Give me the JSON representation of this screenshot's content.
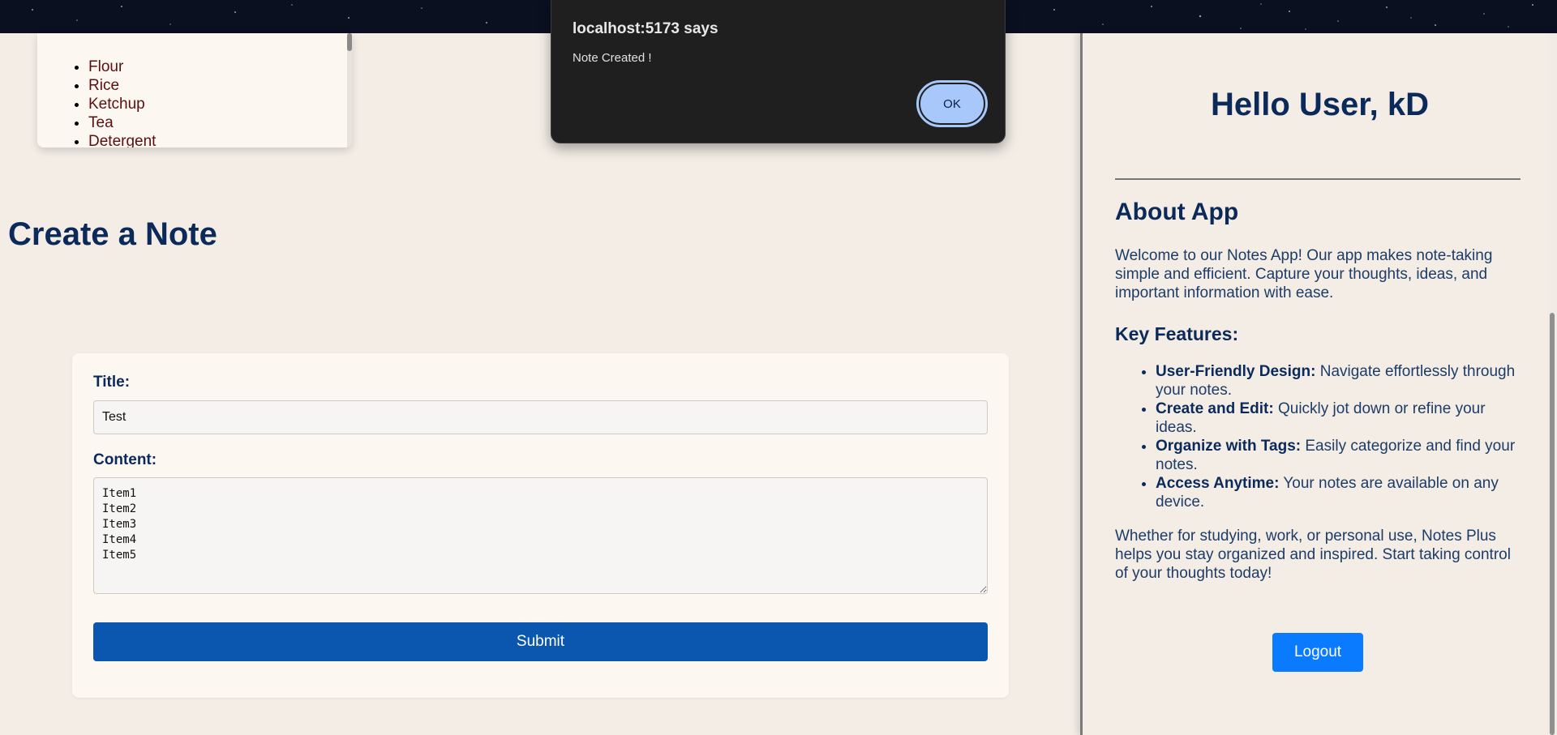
{
  "notes_list": {
    "items": [
      "Flour",
      "Rice",
      "Ketchup",
      "Tea",
      "Detergent"
    ]
  },
  "form": {
    "heading": "Create a Note",
    "title_label": "Title:",
    "title_value": "Test",
    "content_label": "Content:",
    "content_value": "Item1\nItem2\nItem3\nItem4\nItem5",
    "submit_label": "Submit"
  },
  "sidebar": {
    "greeting": "Hello User, kD",
    "about_heading": "About App",
    "about_text": "Welcome to our Notes App! Our app makes note-taking simple and efficient. Capture your thoughts, ideas, and important information with ease.",
    "features_heading": "Key Features:",
    "features": [
      {
        "title": "User-Friendly Design:",
        "text": " Navigate effortlessly through your notes."
      },
      {
        "title": "Create and Edit:",
        "text": " Quickly jot down or refine your ideas."
      },
      {
        "title": "Organize with Tags:",
        "text": " Easily categorize and find your notes."
      },
      {
        "title": "Access Anytime:",
        "text": " Your notes are available on any device."
      }
    ],
    "closing_text": "Whether for studying, work, or personal use, Notes Plus helps you stay organized and inspired. Start taking control of your thoughts today!",
    "logout_label": "Logout"
  },
  "alert": {
    "origin": "localhost:5173 says",
    "message": "Note Created !",
    "ok_label": "OK"
  },
  "colors": {
    "accent": "#0b57b0",
    "heading": "#0b2a5a",
    "logout": "#0a7bff",
    "alert_bg": "#1f1f1f",
    "alert_ok": "#a8c7fa"
  }
}
